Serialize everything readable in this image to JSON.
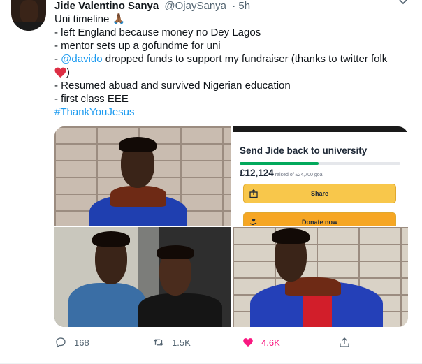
{
  "tweet": {
    "author_name": "Jide Valentino Sanya",
    "handle": "@OjaySanya",
    "time": "· 5h",
    "lines": {
      "l1": "Uni timeline 🙏🏾",
      "l2": "- left England because money no Dey Lagos",
      "l3": "- mentor sets up a gofundme for uni",
      "l4_prefix": "- ",
      "l4_mention": "@davido",
      "l4_rest": " dropped funds to support my fundraiser (thanks to twitter folk",
      "l5_close": ")",
      "l6": "- Resumed abuad and survived Nigerian education",
      "l7": "- first class EEE",
      "l8_hashtag": "#ThankYouJesus"
    }
  },
  "gofundme": {
    "title": "Send Jide back to university",
    "raised": "£12,124",
    "goal": "raised of £24,700 goal",
    "progress_fraction": 0.49,
    "share_label": "Share",
    "donate_label": "Donate now"
  },
  "actions": {
    "replies": "168",
    "retweets": "1.5K",
    "likes": "4.6K",
    "like_color": "#f91880",
    "icons": [
      "reply-icon",
      "retweet-icon",
      "heart-icon",
      "share-icon"
    ]
  },
  "colors": {
    "accent": "#1d9bf0",
    "muted": "#536471",
    "gofundme_green": "#02a95c"
  }
}
